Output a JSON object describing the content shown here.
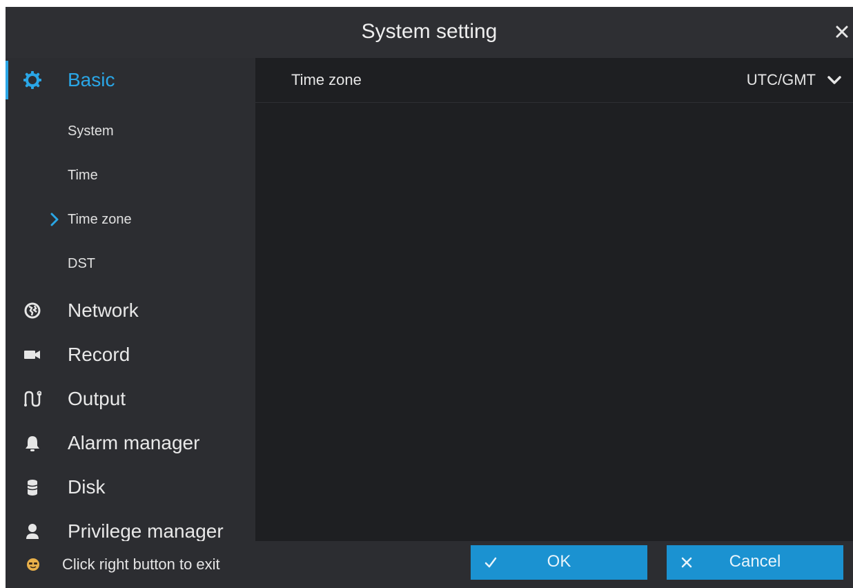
{
  "window": {
    "title": "System setting"
  },
  "colors": {
    "accent": "#2aa6e6",
    "button": "#1b92d1",
    "background": "#1f2023",
    "sidebar": "#2c2d31"
  },
  "sidebar": {
    "basic": {
      "label": "Basic",
      "icon": "gear-icon"
    },
    "subitems": [
      {
        "label": "System"
      },
      {
        "label": "Time"
      },
      {
        "label": "Time zone",
        "selected": true
      },
      {
        "label": "DST"
      }
    ],
    "items": [
      {
        "label": "Network",
        "icon": "globe-icon"
      },
      {
        "label": "Record",
        "icon": "video-camera-icon"
      },
      {
        "label": "Output",
        "icon": "output-icon"
      },
      {
        "label": "Alarm manager",
        "icon": "bell-icon"
      },
      {
        "label": "Disk",
        "icon": "disk-icon"
      },
      {
        "label": "Privilege manager",
        "icon": "user-icon"
      }
    ]
  },
  "content": {
    "timezone_label": "Time zone",
    "timezone_value": "UTC/GMT"
  },
  "footer": {
    "hint": "Click right button to exit",
    "ok_label": "OK",
    "cancel_label": "Cancel"
  }
}
